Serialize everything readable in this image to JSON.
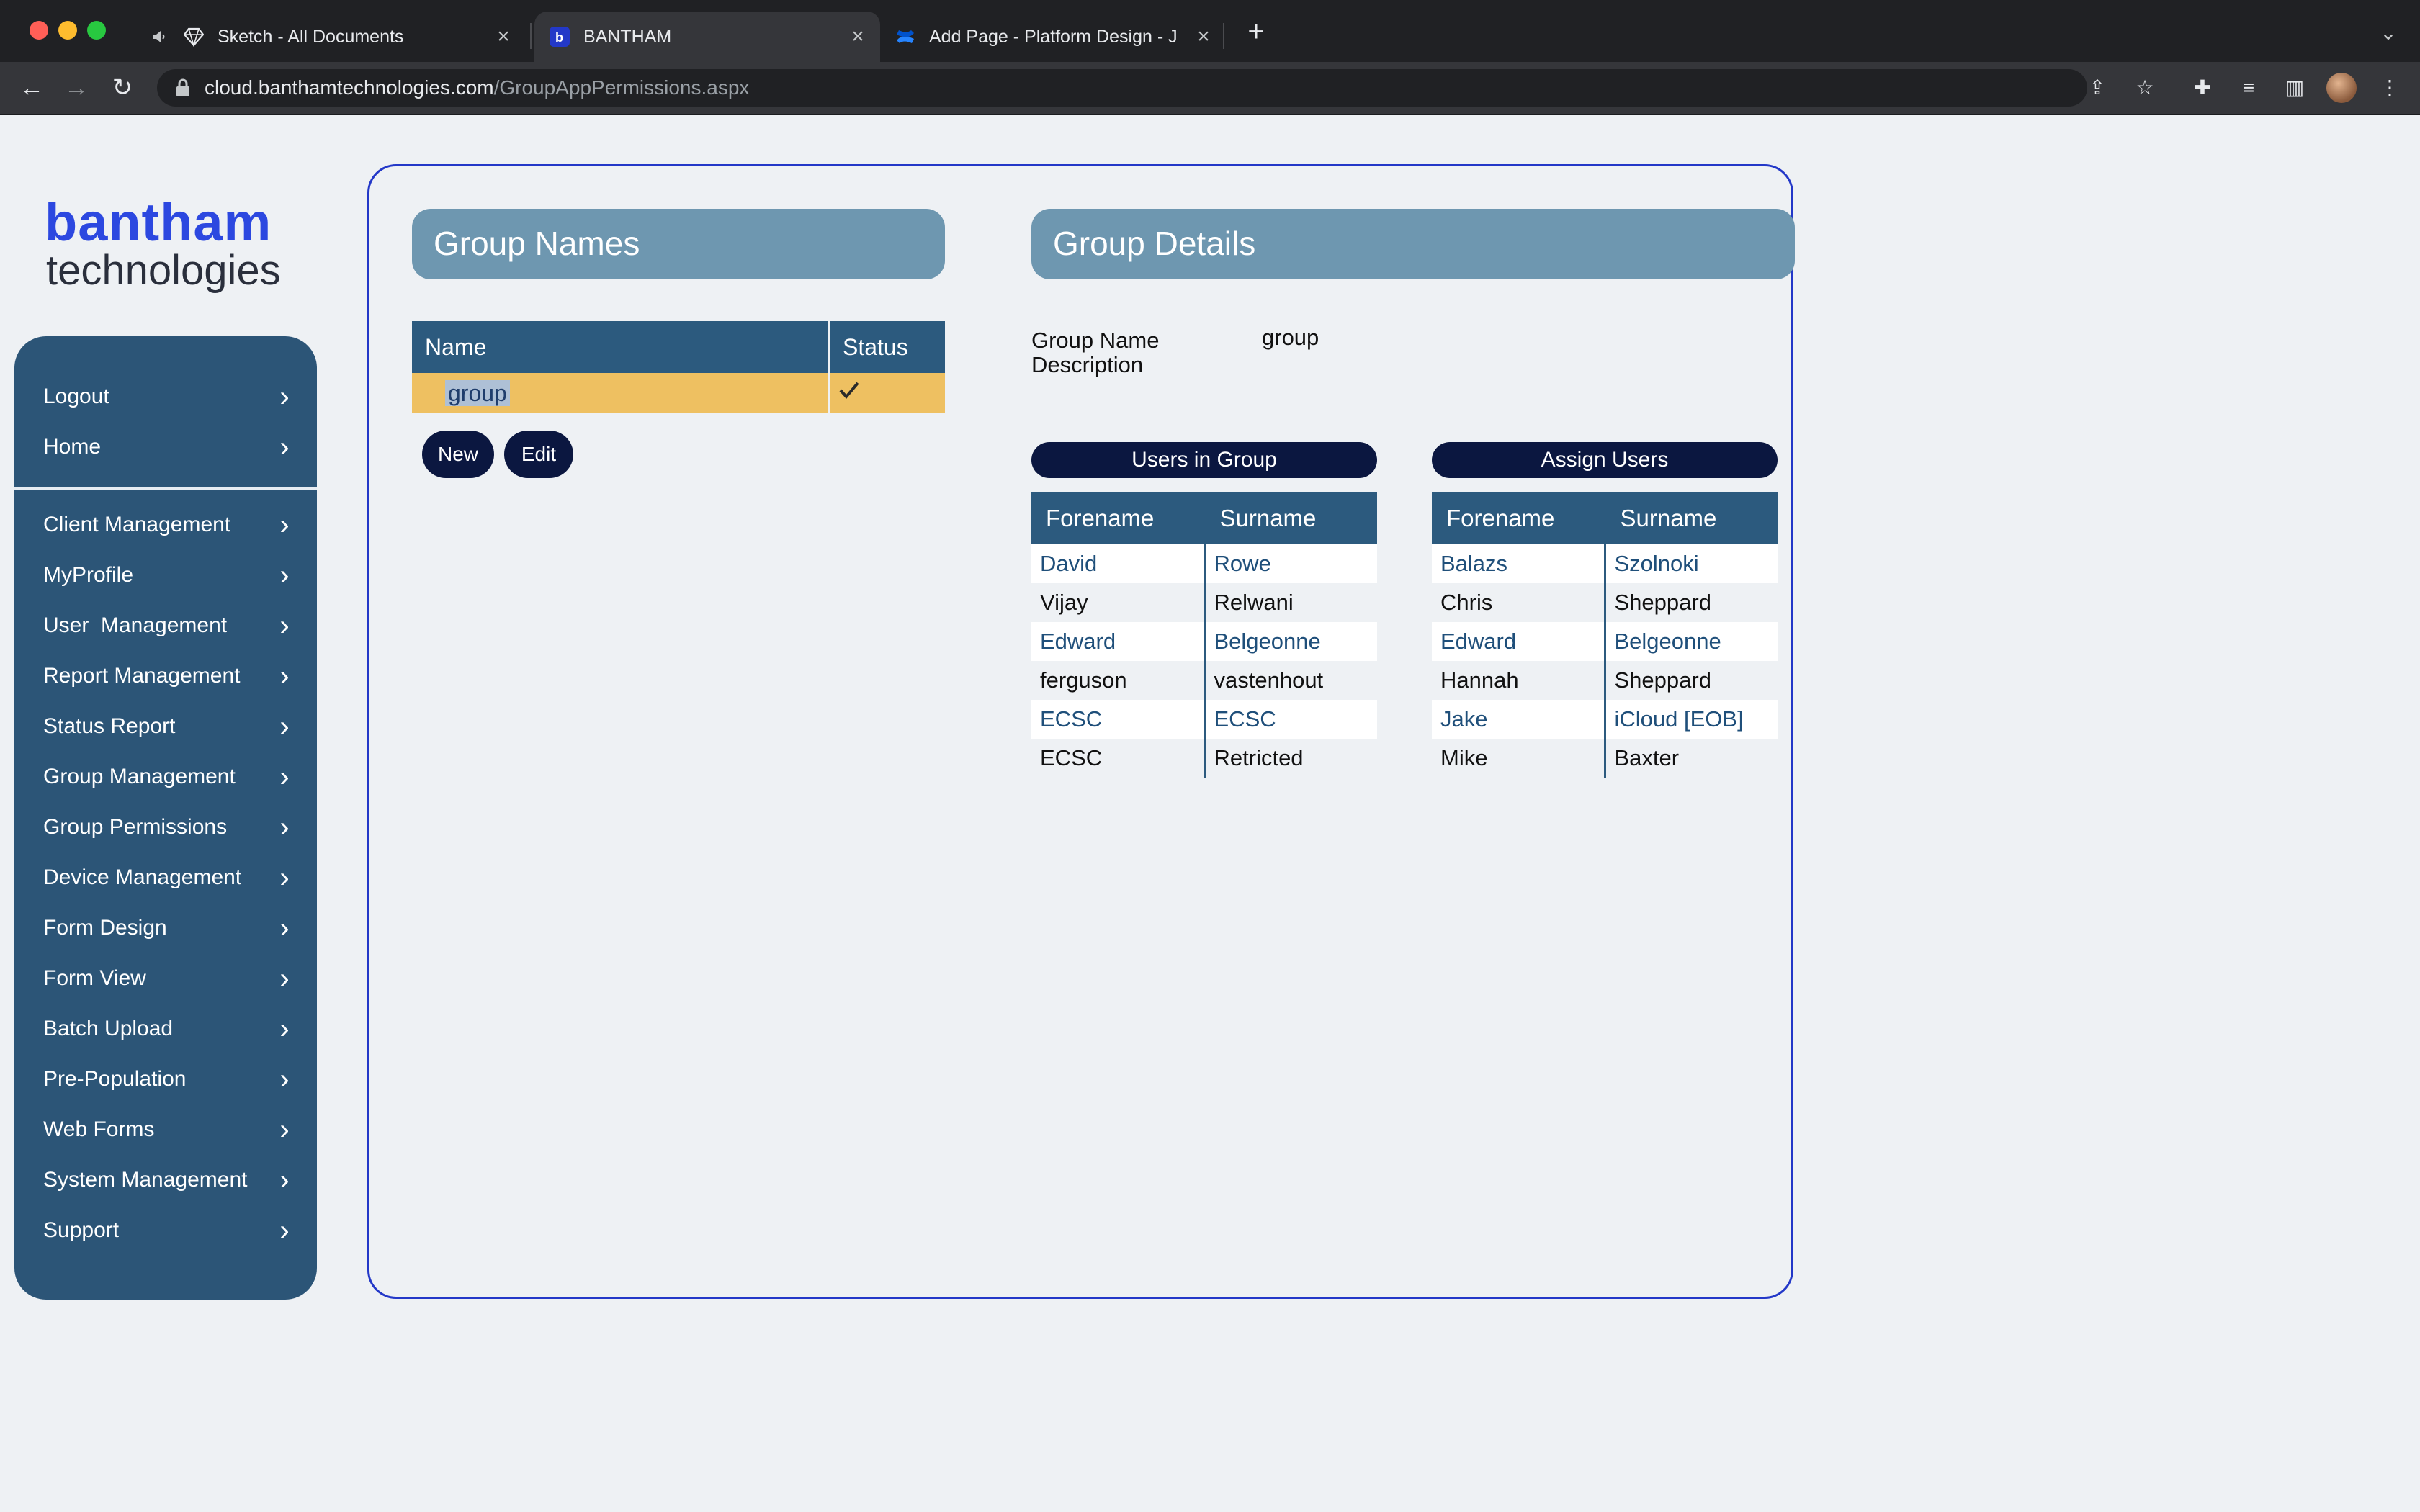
{
  "browser": {
    "tabs": [
      {
        "label": "Sketch - All Documents"
      },
      {
        "label": "BANTHAM"
      },
      {
        "label": "Add Page - Platform Design - J"
      }
    ],
    "url_host": "cloud.banthamtechnologies.com",
    "url_path": "/GroupAppPermissions.aspx"
  },
  "logo": {
    "line1": "bantham",
    "line2": "technologies"
  },
  "sidebar": {
    "top_items": [
      {
        "label": "Logout"
      },
      {
        "label": "Home"
      }
    ],
    "items": [
      {
        "label": "Client Management"
      },
      {
        "label": "MyProfile"
      },
      {
        "label": "User  Management"
      },
      {
        "label": "Report Management"
      },
      {
        "label": "Status Report"
      },
      {
        "label": "Group Management"
      },
      {
        "label": "Group Permissions"
      },
      {
        "label": "Device Management"
      },
      {
        "label": "Form Design"
      },
      {
        "label": "Form View"
      },
      {
        "label": "Batch Upload"
      },
      {
        "label": "Pre-Population"
      },
      {
        "label": "Web Forms"
      },
      {
        "label": "System Management"
      },
      {
        "label": "Support"
      }
    ]
  },
  "group_names": {
    "title": "Group Names",
    "columns": [
      "Name",
      "Status"
    ],
    "rows": [
      {
        "name": "group",
        "status": "active"
      }
    ],
    "new_label": "New",
    "edit_label": "Edit"
  },
  "group_details": {
    "title": "Group Details",
    "name_label": "Group Name",
    "name_value": "group",
    "description_label": "Description",
    "users_in_group": {
      "title": "Users in Group",
      "columns": [
        "Forename",
        "Surname"
      ],
      "rows": [
        [
          "David",
          "Rowe"
        ],
        [
          "Vijay",
          "Relwani"
        ],
        [
          "Edward",
          "Belgeonne"
        ],
        [
          "ferguson",
          "vastenhout"
        ],
        [
          "ECSC",
          "ECSC"
        ],
        [
          "ECSC",
          "Retricted"
        ]
      ]
    },
    "assign_users": {
      "title": "Assign Users",
      "columns": [
        "Forename",
        "Surname"
      ],
      "rows": [
        [
          "Balazs",
          "Szolnoki"
        ],
        [
          "Chris",
          "Sheppard"
        ],
        [
          "Edward",
          "Belgeonne"
        ],
        [
          "Hannah",
          "Sheppard"
        ],
        [
          "Jake",
          "iCloud [EOB]"
        ],
        [
          "Mike",
          "Baxter"
        ]
      ]
    }
  },
  "colors": {
    "sidebar": "#2c5577",
    "panel_header": "#6e97b0",
    "table_header": "#2c5a7e",
    "selected_row": "#eec061",
    "pill": "#0b1740",
    "frame_border": "#2338c8",
    "logo_blue": "#2c48e0"
  }
}
